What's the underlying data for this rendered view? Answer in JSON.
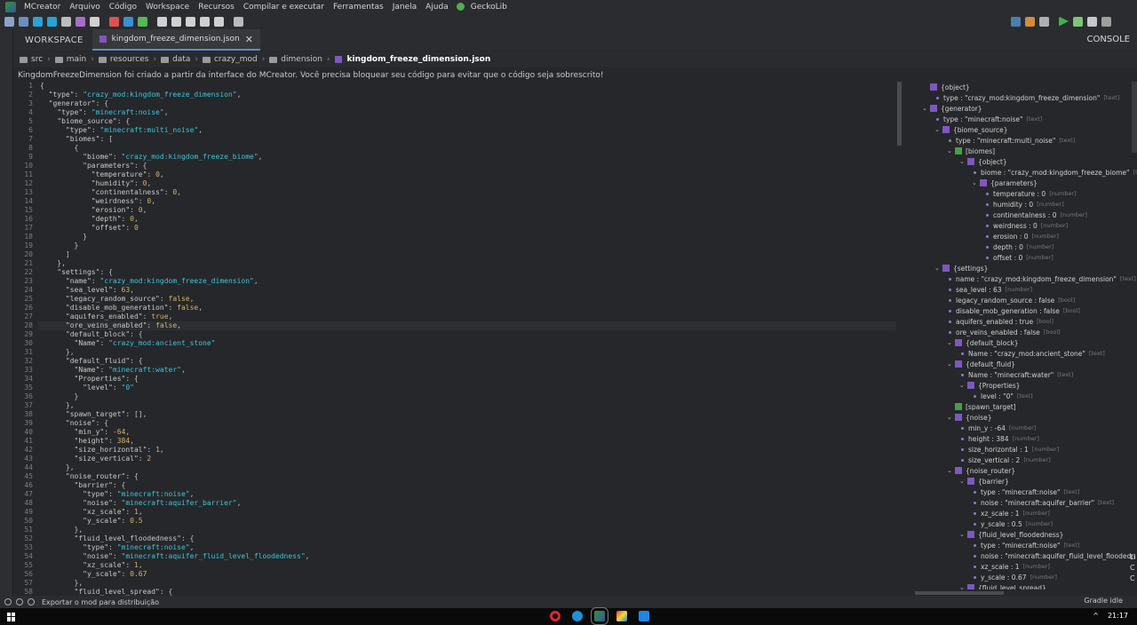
{
  "menubar": {
    "items": [
      "MCreator",
      "Arquivo",
      "Código",
      "Workspace",
      "Recursos",
      "Compilar e executar",
      "Ferramentas",
      "Janela",
      "Ajuda",
      "GeckoLib"
    ]
  },
  "tabs": {
    "workspace_label": "WORKSPACE",
    "file_tab": "kingdom_freeze_dimension.json",
    "close_glyph": "✕",
    "console_label": "CONSOLE"
  },
  "breadcrumb": [
    "src",
    "main",
    "resources",
    "data",
    "crazy_mod",
    "dimension",
    "kingdom_freeze_dimension.json"
  ],
  "notice": "KingdomFreezeDimension foi criado a partir da interface do MCreator. Você precisa bloquear seu código para evitar que o código seja sobrescrito!",
  "code_lines": [
    "{",
    "  \"type\": \"crazy_mod:kingdom_freeze_dimension\",",
    "  \"generator\": {",
    "    \"type\": \"minecraft:noise\",",
    "    \"biome_source\": {",
    "      \"type\": \"minecraft:multi_noise\",",
    "      \"biomes\": [",
    "        {",
    "          \"biome\": \"crazy_mod:kingdom_freeze_biome\",",
    "          \"parameters\": {",
    "            \"temperature\": 0,",
    "            \"humidity\": 0,",
    "            \"continentalness\": 0,",
    "            \"weirdness\": 0,",
    "            \"erosion\": 0,",
    "            \"depth\": 0,",
    "            \"offset\": 0",
    "          }",
    "        }",
    "      ]",
    "    },",
    "    \"settings\": {",
    "      \"name\": \"crazy_mod:kingdom_freeze_dimension\",",
    "      \"sea_level\": 63,",
    "      \"legacy_random_source\": false,",
    "      \"disable_mob_generation\": false,",
    "      \"aquifers_enabled\": true,",
    "      \"ore_veins_enabled\": false,",
    "      \"default_block\": {",
    "        \"Name\": \"crazy_mod:ancient_stone\"",
    "      },",
    "      \"default_fluid\": {",
    "        \"Name\": \"minecraft:water\",",
    "        \"Properties\": {",
    "          \"level\": \"0\"",
    "        }",
    "      },",
    "      \"spawn_target\": [],",
    "      \"noise\": {",
    "        \"min_y\": -64,",
    "        \"height\": 384,",
    "        \"size_horizontal\": 1,",
    "        \"size_vertical\": 2",
    "      },",
    "      \"noise_router\": {",
    "        \"barrier\": {",
    "          \"type\": \"minecraft:noise\",",
    "          \"noise\": \"minecraft:aquifer_barrier\",",
    "          \"xz_scale\": 1,",
    "          \"y_scale\": 0.5",
    "        },",
    "        \"fluid_level_floodedness\": {",
    "          \"type\": \"minecraft:noise\",",
    "          \"noise\": \"minecraft:aquifer_fluid_level_floodedness\",",
    "          \"xz_scale\": 1,",
    "          \"y_scale\": 0.67",
    "        },",
    "        \"fluid_level_spread\": {"
  ],
  "tree": [
    {
      "d": 0,
      "kind": "obj",
      "arrow": "",
      "label": "{object}",
      "t": ""
    },
    {
      "d": 1,
      "kind": "leaf",
      "arrow": "",
      "label": "type : \"crazy_mod:kingdom_freeze_dimension\"",
      "t": "[text]"
    },
    {
      "d": 0,
      "kind": "obj",
      "arrow": "v",
      "label": "{generator}",
      "t": ""
    },
    {
      "d": 1,
      "kind": "leaf",
      "arrow": "",
      "label": "type : \"minecraft:noise\"",
      "t": "[text]"
    },
    {
      "d": 1,
      "kind": "obj",
      "arrow": "v",
      "label": "{biome_source}",
      "t": ""
    },
    {
      "d": 2,
      "kind": "leaf",
      "arrow": "",
      "label": "type : \"minecraft:multi_noise\"",
      "t": "[text]"
    },
    {
      "d": 2,
      "kind": "arr",
      "arrow": "v",
      "label": "[biomes]",
      "t": ""
    },
    {
      "d": 3,
      "kind": "obj",
      "arrow": "v",
      "label": "{object}",
      "t": ""
    },
    {
      "d": 4,
      "kind": "leaf",
      "arrow": "",
      "label": "biome : \"crazy_mod:kingdom_freeze_biome\"",
      "t": "[text]"
    },
    {
      "d": 4,
      "kind": "obj",
      "arrow": "v",
      "label": "{parameters}",
      "t": ""
    },
    {
      "d": 5,
      "kind": "leaf",
      "arrow": "",
      "label": "temperature : 0",
      "t": "[number]"
    },
    {
      "d": 5,
      "kind": "leaf",
      "arrow": "",
      "label": "humidity : 0",
      "t": "[number]"
    },
    {
      "d": 5,
      "kind": "leaf",
      "arrow": "",
      "label": "continentalness : 0",
      "t": "[number]"
    },
    {
      "d": 5,
      "kind": "leaf",
      "arrow": "",
      "label": "weirdness : 0",
      "t": "[number]"
    },
    {
      "d": 5,
      "kind": "leaf",
      "arrow": "",
      "label": "erosion : 0",
      "t": "[number]"
    },
    {
      "d": 5,
      "kind": "leaf",
      "arrow": "",
      "label": "depth : 0",
      "t": "[number]"
    },
    {
      "d": 5,
      "kind": "leaf",
      "arrow": "",
      "label": "offset : 0",
      "t": "[number]"
    },
    {
      "d": 1,
      "kind": "obj",
      "arrow": "v",
      "label": "{settings}",
      "t": ""
    },
    {
      "d": 2,
      "kind": "leaf",
      "arrow": "",
      "label": "name : \"crazy_mod:kingdom_freeze_dimension\"",
      "t": "[text]"
    },
    {
      "d": 2,
      "kind": "leaf",
      "arrow": "",
      "label": "sea_level : 63",
      "t": "[number]"
    },
    {
      "d": 2,
      "kind": "leaf",
      "arrow": "",
      "label": "legacy_random_source : false",
      "t": "[bool]"
    },
    {
      "d": 2,
      "kind": "leaf",
      "arrow": "",
      "label": "disable_mob_generation : false",
      "t": "[bool]"
    },
    {
      "d": 2,
      "kind": "leaf",
      "arrow": "",
      "label": "aquifers_enabled : true",
      "t": "[bool]"
    },
    {
      "d": 2,
      "kind": "leaf",
      "arrow": "",
      "label": "ore_veins_enabled : false",
      "t": "[bool]"
    },
    {
      "d": 2,
      "kind": "obj",
      "arrow": "v",
      "label": "{default_block}",
      "t": ""
    },
    {
      "d": 3,
      "kind": "leaf",
      "arrow": "",
      "label": "Name : \"crazy_mod:ancient_stone\"",
      "t": "[text]"
    },
    {
      "d": 2,
      "kind": "obj",
      "arrow": "v",
      "label": "{default_fluid}",
      "t": ""
    },
    {
      "d": 3,
      "kind": "leaf",
      "arrow": "",
      "label": "Name : \"minecraft:water\"",
      "t": "[text]"
    },
    {
      "d": 3,
      "kind": "obj",
      "arrow": "v",
      "label": "{Properties}",
      "t": ""
    },
    {
      "d": 4,
      "kind": "leaf",
      "arrow": "",
      "label": "level : \"0\"",
      "t": "[text]"
    },
    {
      "d": 2,
      "kind": "arr",
      "arrow": "",
      "label": "[spawn_target]",
      "t": ""
    },
    {
      "d": 2,
      "kind": "obj",
      "arrow": "v",
      "label": "{noise}",
      "t": ""
    },
    {
      "d": 3,
      "kind": "leaf",
      "arrow": "",
      "label": "min_y : -64",
      "t": "[number]"
    },
    {
      "d": 3,
      "kind": "leaf",
      "arrow": "",
      "label": "height : 384",
      "t": "[number]"
    },
    {
      "d": 3,
      "kind": "leaf",
      "arrow": "",
      "label": "size_horizontal : 1",
      "t": "[number]"
    },
    {
      "d": 3,
      "kind": "leaf",
      "arrow": "",
      "label": "size_vertical : 2",
      "t": "[number]"
    },
    {
      "d": 2,
      "kind": "obj",
      "arrow": "v",
      "label": "{noise_router}",
      "t": ""
    },
    {
      "d": 3,
      "kind": "obj",
      "arrow": "v",
      "label": "{barrier}",
      "t": ""
    },
    {
      "d": 4,
      "kind": "leaf",
      "arrow": "",
      "label": "type : \"minecraft:noise\"",
      "t": "[text]"
    },
    {
      "d": 4,
      "kind": "leaf",
      "arrow": "",
      "label": "noise : \"minecraft:aquifer_barrier\"",
      "t": "[text]"
    },
    {
      "d": 4,
      "kind": "leaf",
      "arrow": "",
      "label": "xz_scale : 1",
      "t": "[number]"
    },
    {
      "d": 4,
      "kind": "leaf",
      "arrow": "",
      "label": "y_scale : 0.5",
      "t": "[number]"
    },
    {
      "d": 3,
      "kind": "obj",
      "arrow": "v",
      "label": "{fluid_level_floodedness}",
      "t": ""
    },
    {
      "d": 4,
      "kind": "leaf",
      "arrow": "",
      "label": "type : \"minecraft:noise\"",
      "t": "[text]"
    },
    {
      "d": 4,
      "kind": "leaf",
      "arrow": "",
      "label": "noise : \"minecraft:aquifer_fluid_level_floodedn",
      "t": ""
    },
    {
      "d": 4,
      "kind": "leaf",
      "arrow": "",
      "label": "xz_scale : 1",
      "t": "[number]"
    },
    {
      "d": 4,
      "kind": "leaf",
      "arrow": "",
      "label": "y_scale : 0.67",
      "t": "[number]"
    },
    {
      "d": 3,
      "kind": "obj",
      "arrow": "v",
      "label": "{fluid_level_spread}",
      "t": ""
    }
  ],
  "side_letters": [
    "Li",
    "C",
    "C"
  ],
  "status": {
    "text": "Exportar o mod para distribuição",
    "gradle": "Gradle idle"
  },
  "taskbar": {
    "clock": "21:17",
    "tray_arrow": "^"
  },
  "colors": {
    "accent": "#5d8fc7",
    "object_icon": "#7e57c2",
    "array_icon": "#43a047",
    "string": "#38c7d7",
    "number": "#d2b36b"
  }
}
